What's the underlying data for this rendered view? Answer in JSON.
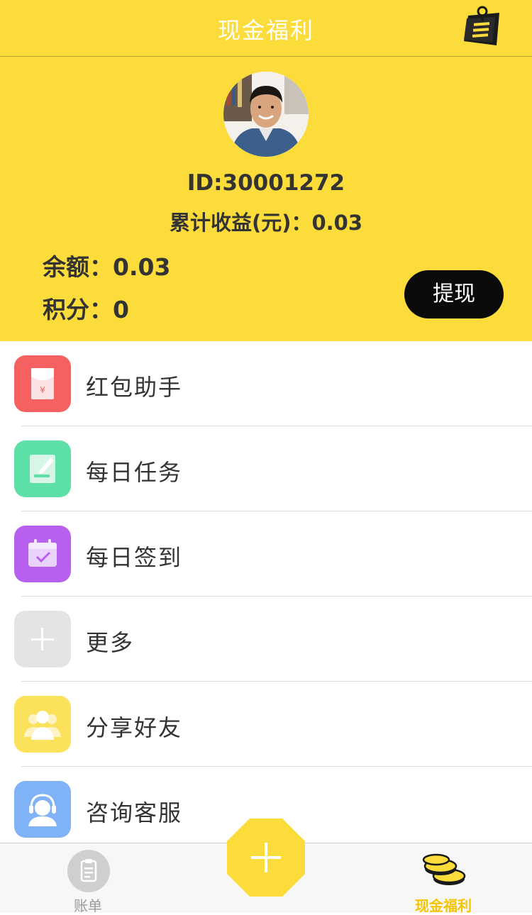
{
  "header": {
    "title": "现金福利",
    "icons": {
      "right": "notes-pin-icon"
    },
    "background_color": "#fbdc3a"
  },
  "profile": {
    "id_label": "ID:30001272",
    "total_earnings": "累计收益(元)：0.03",
    "balance": "余额：0.03",
    "points": "积分：0",
    "withdraw_label": "提现"
  },
  "menu": {
    "items": [
      {
        "label": "红包助手",
        "icon": "red-envelope-icon",
        "color": "#f56161"
      },
      {
        "label": "每日任务",
        "icon": "edit-note-icon",
        "color": "#5ce0a6"
      },
      {
        "label": "每日签到",
        "icon": "calendar-check-icon",
        "color": "#b760f0"
      },
      {
        "label": "更多",
        "icon": "plus-icon",
        "color": "#e4e4e4"
      },
      {
        "label": "分享好友",
        "icon": "group-users-icon",
        "color": "#fbe25a"
      },
      {
        "label": "咨询客服",
        "icon": "headset-user-icon",
        "color": "#7fb2f7"
      }
    ]
  },
  "tabbar": {
    "bills_label": "账单",
    "cash_label": "现金福利",
    "bills_icon": "clipboard-icon",
    "cash_icon": "coin-stack-icon",
    "center_icon": "plus-icon",
    "active_color": "#f5c400"
  }
}
